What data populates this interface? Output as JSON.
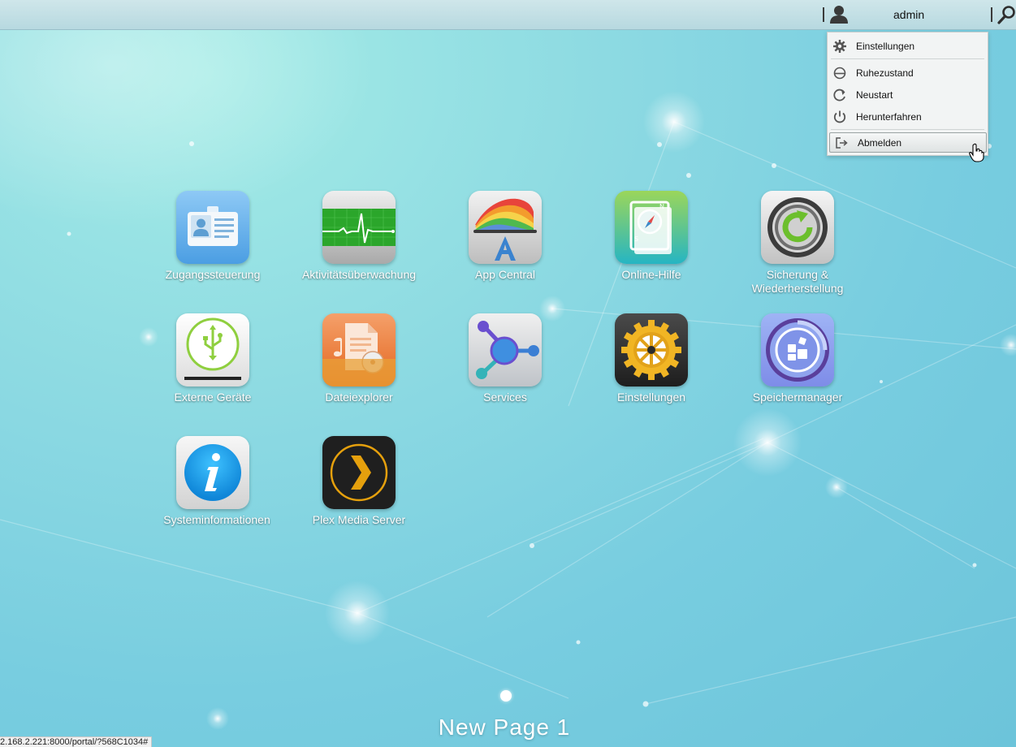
{
  "topbar": {
    "username": "admin",
    "user_icon": "user-icon",
    "search_icon": "search-icon"
  },
  "user_menu": {
    "items": [
      {
        "label": "Einstellungen",
        "icon": "gear-icon"
      },
      {
        "label": "Ruhezustand",
        "icon": "sleep-icon"
      },
      {
        "label": "Neustart",
        "icon": "restart-icon"
      },
      {
        "label": "Herunterfahren",
        "icon": "power-icon"
      },
      {
        "label": "Abmelden",
        "icon": "logout-icon",
        "state": "hover"
      }
    ]
  },
  "apps": [
    {
      "label": "Zugangssteuerung",
      "icon": "id-card-icon"
    },
    {
      "label": "Aktivitätsüberwachung",
      "icon": "heartbeat-monitor-icon"
    },
    {
      "label": "App Central",
      "icon": "app-central-icon"
    },
    {
      "label": "Online-Hilfe",
      "icon": "compass-book-icon"
    },
    {
      "label": "Sicherung & Wiederherstellung",
      "icon": "backup-restore-icon"
    },
    {
      "label": "Externe Geräte",
      "icon": "usb-icon"
    },
    {
      "label": "Dateiexplorer",
      "icon": "file-explorer-icon"
    },
    {
      "label": "Services",
      "icon": "services-icon"
    },
    {
      "label": "Einstellungen",
      "icon": "settings-cog-icon"
    },
    {
      "label": "Speichermanager",
      "icon": "storage-manager-icon"
    },
    {
      "label": "Systeminformationen",
      "icon": "info-icon"
    },
    {
      "label": "Plex Media Server",
      "icon": "plex-icon"
    }
  ],
  "page": {
    "title": "New Page 1",
    "indicator_count": 1,
    "active_index": 0
  },
  "status_bar": {
    "url": "2.168.2.221:8000/portal/?568C1034#"
  },
  "colors": {
    "background": "#8ddae2",
    "topbar": "#c3e0e6",
    "menu_bg": "#f2f4f4",
    "label_text": "#ffffff"
  }
}
